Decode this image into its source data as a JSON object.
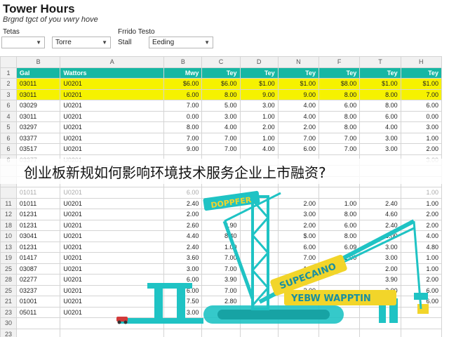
{
  "header": {
    "title": "Tower Hours",
    "subtitle": "Brgnd tgct of you vwry hove"
  },
  "filters": [
    {
      "label": "Tetas",
      "value": ""
    },
    {
      "label": "",
      "value": "Torre"
    },
    {
      "label": "Frrido Testo",
      "value": ""
    },
    {
      "label": "Stall",
      "value": "Eeding"
    }
  ],
  "columns": [
    "B",
    "A",
    "B",
    "C",
    "D",
    "N",
    "F",
    "T",
    "H"
  ],
  "header_row": {
    "num": "1",
    "cells": [
      "Gal",
      "Wattors",
      "Mwy",
      "Tey",
      "Tey",
      "Tey",
      "Tey",
      "Tey",
      "Tey"
    ]
  },
  "rows": [
    {
      "num": "2",
      "cells": [
        "03011",
        "U0201",
        "$6.00",
        "$6.00",
        "$1.00",
        "$1.00",
        "$8.00",
        "$1.00",
        "$1.00"
      ]
    },
    {
      "num": "3",
      "cells": [
        "03011",
        "U0201",
        "6.00",
        "8.00",
        "9.00",
        "9.00",
        "8.00",
        "8.00",
        "7.00"
      ]
    },
    {
      "num": "6",
      "cells": [
        "03029",
        "U0201",
        "7.00",
        "5.00",
        "3.00",
        "4.00",
        "6.00",
        "8.00",
        "6.00"
      ]
    },
    {
      "num": "4",
      "cells": [
        "03011",
        "U0201",
        "0.00",
        "3.00",
        "1.00",
        "4.00",
        "8.00",
        "6.00",
        "0.00"
      ]
    },
    {
      "num": "5",
      "cells": [
        "03297",
        "U0201",
        "8.00",
        "4.00",
        "2.00",
        "2.00",
        "8.00",
        "4.00",
        "3.00"
      ]
    },
    {
      "num": "6",
      "cells": [
        "03377",
        "U0201",
        "7.00",
        "7.00",
        "1.00",
        "7.00",
        "7.00",
        "3.00",
        "1.00"
      ]
    },
    {
      "num": "6",
      "cells": [
        "03517",
        "U0201",
        "9.00",
        "7.00",
        "4.00",
        "6.00",
        "7.00",
        "3.00",
        "2.00"
      ]
    },
    {
      "num": "6",
      "cells": [
        "03377",
        "U0201",
        "",
        "",
        "",
        "",
        "",
        "",
        "3.00"
      ]
    },
    {
      "num": "",
      "cells": [
        "",
        "",
        "",
        "",
        "",
        "",
        "",
        "",
        ""
      ]
    },
    {
      "num": "",
      "cells": [
        "",
        "",
        "",
        "",
        "",
        "",
        "",
        "",
        ""
      ]
    },
    {
      "num": "",
      "cells": [
        "01011",
        "U0201",
        "6.00",
        "",
        "",
        "",
        "",
        "",
        "1.00"
      ]
    },
    {
      "num": "11",
      "cells": [
        "01011",
        "U0201",
        "2.40",
        "",
        "",
        "2.00",
        "1.00",
        "2.40",
        "1.00"
      ]
    },
    {
      "num": "12",
      "cells": [
        "01231",
        "U0201",
        "2.00",
        "",
        "",
        "3.00",
        "8.00",
        "4.60",
        "2.00"
      ]
    },
    {
      "num": "18",
      "cells": [
        "01231",
        "U0201",
        "2.60",
        "3.90",
        "",
        "2.00",
        "6.00",
        "2.40",
        "2.00"
      ]
    },
    {
      "num": "10",
      "cells": [
        "03041",
        "U0201",
        "4.40",
        "8.40",
        "",
        "$.00",
        "8.00",
        "3.00",
        "4.00"
      ]
    },
    {
      "num": "13",
      "cells": [
        "01231",
        "U0201",
        "2.40",
        "1.00",
        "",
        "6.00",
        "6.09",
        "3.00",
        "4.80"
      ]
    },
    {
      "num": "19",
      "cells": [
        "01417",
        "U0201",
        "3.60",
        "7.00",
        "",
        "7.00",
        "1.00",
        "3.00",
        "1.00"
      ]
    },
    {
      "num": "25",
      "cells": [
        "03087",
        "U0201",
        "3.00",
        "7.00",
        "",
        "1.00",
        "",
        "2.00",
        "1.00"
      ]
    },
    {
      "num": "28",
      "cells": [
        "02277",
        "U0201",
        "6.00",
        "3.90",
        "",
        "3.00",
        "",
        "3.90",
        "2.00"
      ]
    },
    {
      "num": "25",
      "cells": [
        "03237",
        "U0201",
        "6.00",
        "7.00",
        "",
        "3.00",
        "",
        "3.00",
        "6.00"
      ]
    },
    {
      "num": "21",
      "cells": [
        "01001",
        "U0201",
        "7.50",
        "2.80",
        "",
        "3.00",
        "6.00",
        "2.00",
        "6.00"
      ]
    },
    {
      "num": "23",
      "cells": [
        "05011",
        "U0201",
        "3.00",
        "2.00",
        "",
        "",
        "",
        "",
        ""
      ]
    },
    {
      "num": "30",
      "cells": [
        "",
        "",
        "",
        "",
        "",
        "",
        "",
        "",
        ""
      ]
    },
    {
      "num": "23",
      "cells": [
        "",
        "",
        "",
        "",
        "",
        "",
        "",
        "",
        ""
      ]
    },
    {
      "num": "8",
      "cells": [
        "",
        "",
        "",
        "",
        "",
        "",
        "",
        "",
        ""
      ]
    }
  ],
  "overlay_title": "创业板新规如何影响环境技术服务企业上市融资?",
  "crane_signs": {
    "top": "DOPPFER",
    "middle": "SUPECAINO",
    "bottom": "YEBW WAPPTIN"
  },
  "colors": {
    "header_teal": "#16b7a3",
    "highlight_yellow": "#f6f200",
    "crane_cyan": "#1fc3c4",
    "sign_yellow": "#f2d52a"
  }
}
